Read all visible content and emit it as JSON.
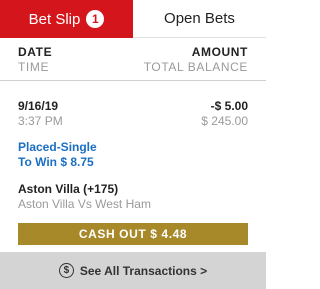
{
  "tabs": [
    {
      "label": "Bet Slip",
      "badge": "1",
      "active": true
    },
    {
      "label": "Open Bets",
      "active": false
    }
  ],
  "header": {
    "left_title": "DATE",
    "left_sub": "TIME",
    "right_title": "AMOUNT",
    "right_sub": "TOTAL BALANCE"
  },
  "transaction": {
    "date": "9/16/19",
    "time": "3:37 PM",
    "amount": "-$ 5.00",
    "balance": "$ 245.00",
    "bet_type": "Placed-Single",
    "to_win": "To Win $ 8.75",
    "selection": "Aston Villa (+175)",
    "event": "Aston Villa Vs West Ham",
    "cashout_label": "CASH OUT $ 4.48"
  },
  "footer": {
    "icon": "dollar-circle-icon",
    "label": "See All Transactions >"
  },
  "colors": {
    "accent_red": "#d4161c",
    "link_blue": "#1a6fc4",
    "cashout_gold": "#a8892a"
  }
}
